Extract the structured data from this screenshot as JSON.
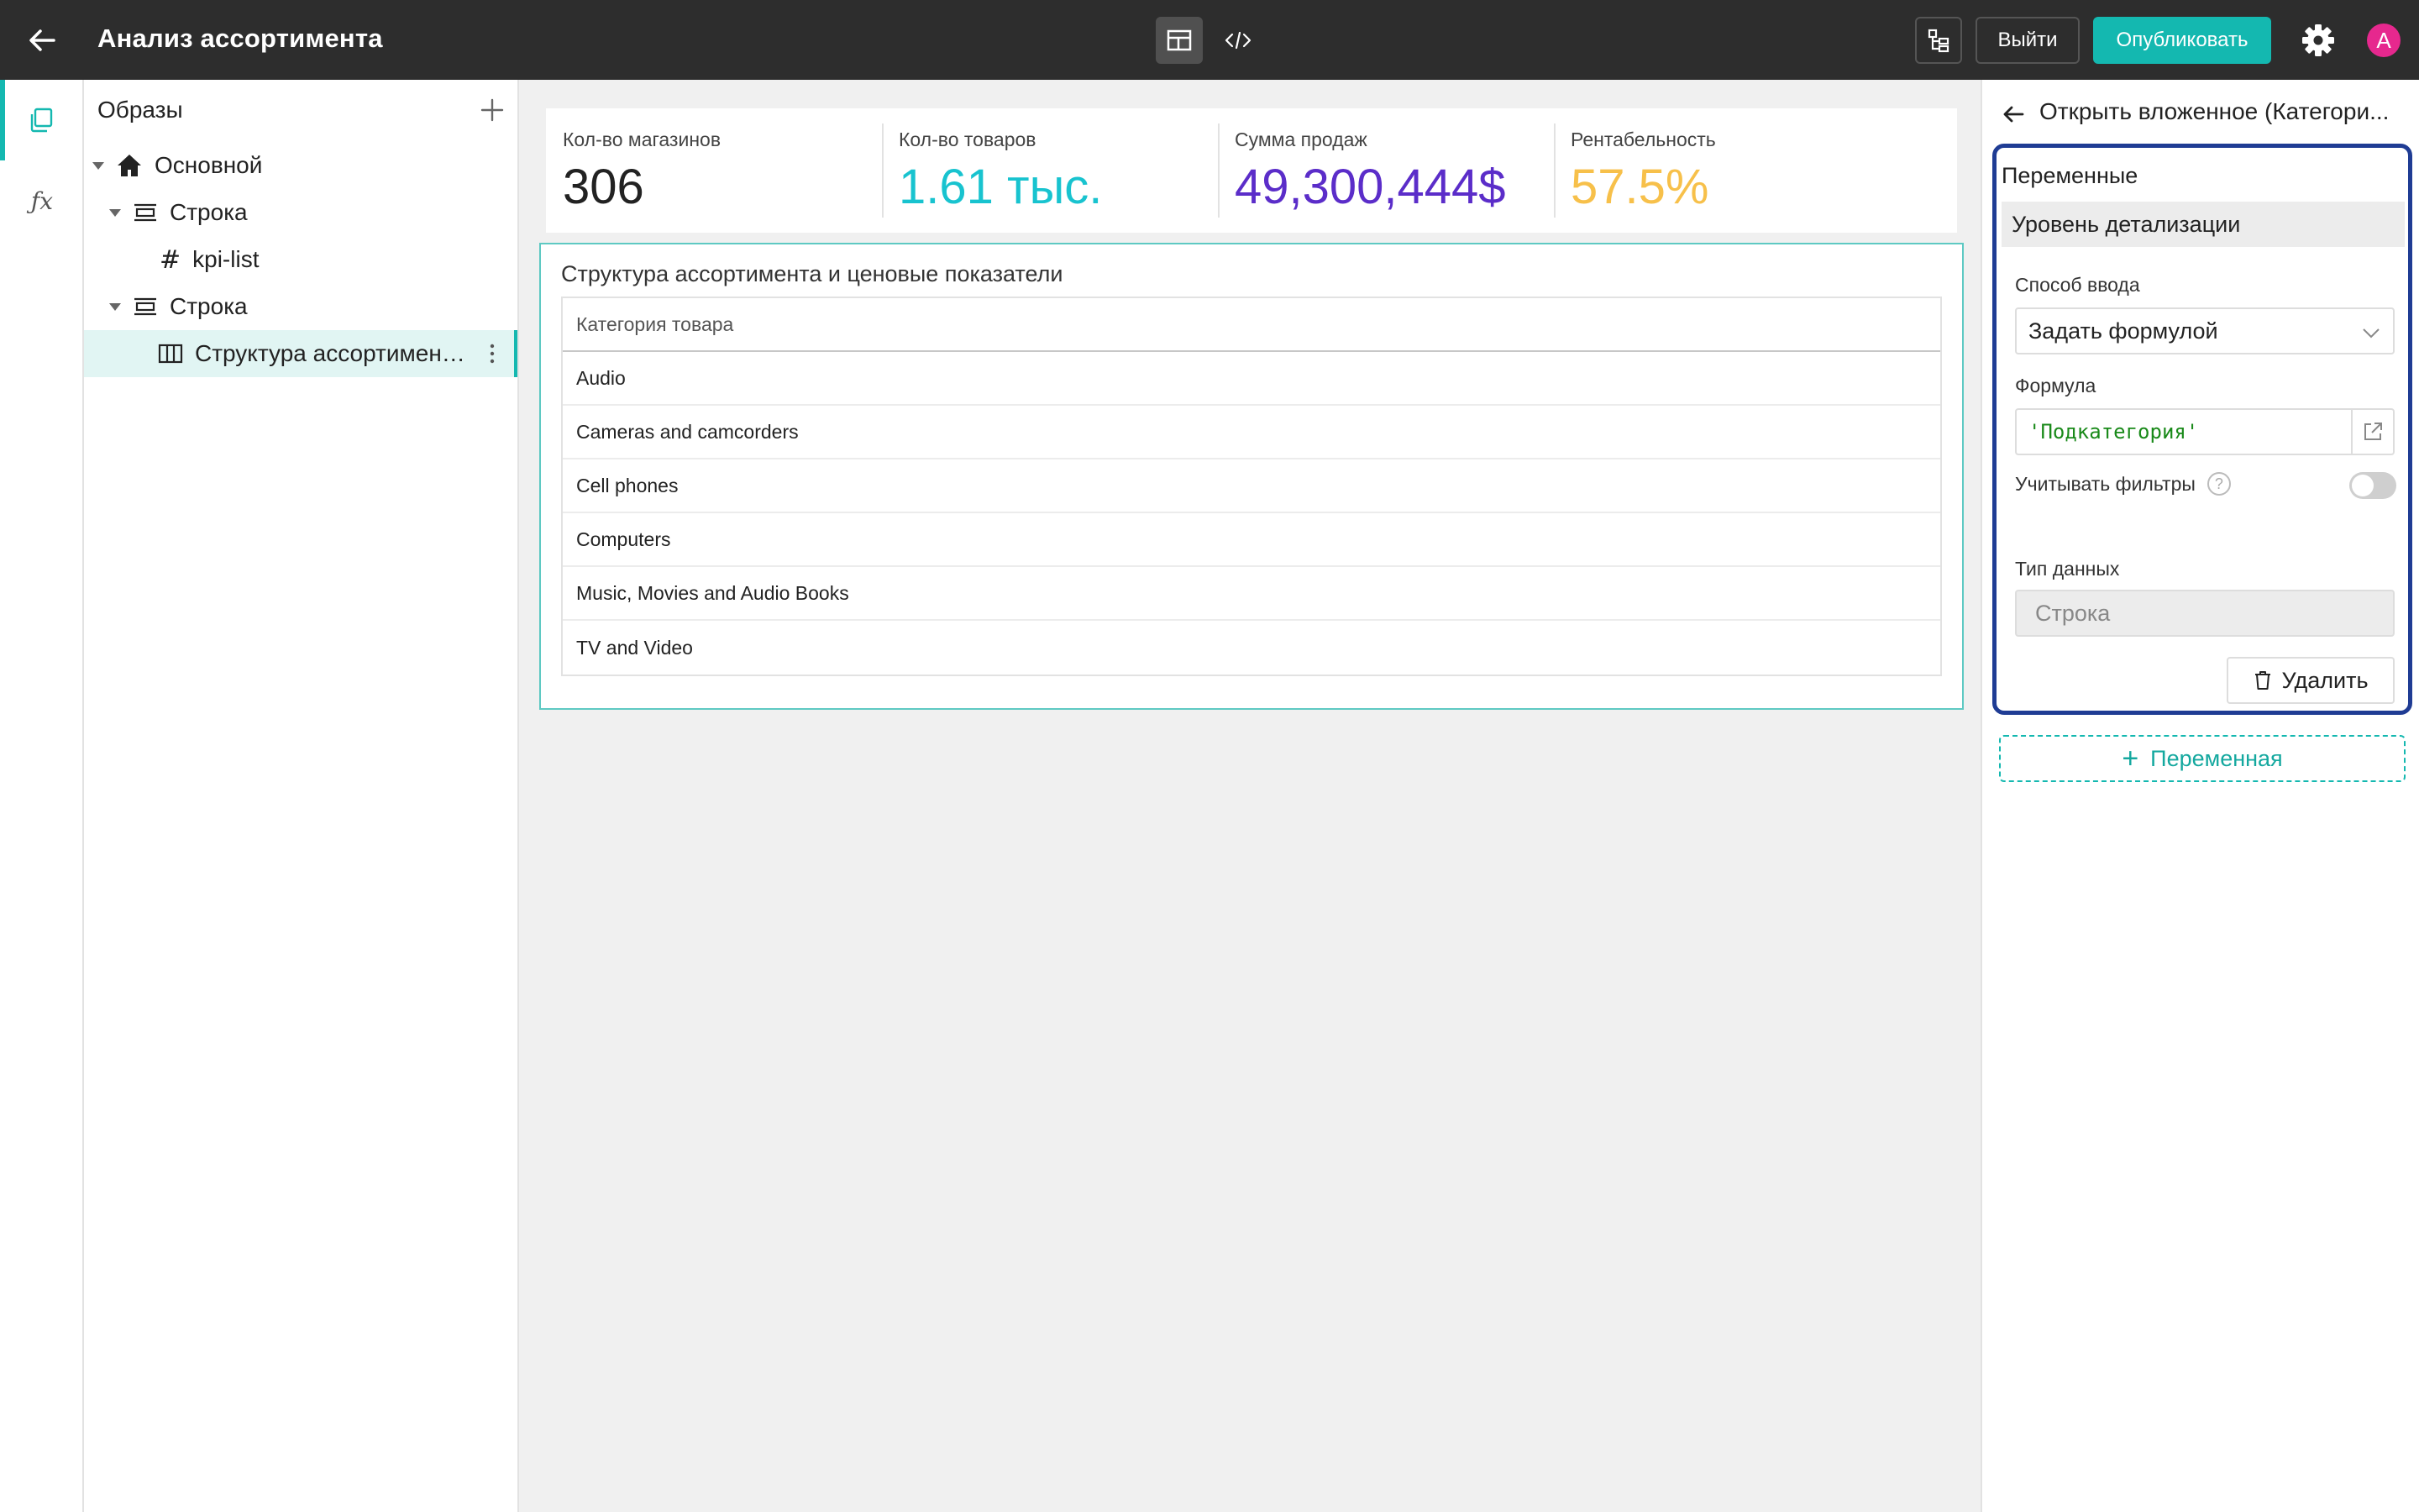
{
  "header": {
    "title": "Анализ ассортимента",
    "exit_label": "Выйти",
    "publish_label": "Опубликовать",
    "avatar_initial": "A"
  },
  "tree": {
    "title": "Образы",
    "items": [
      {
        "label": "Основной",
        "icon": "home-icon"
      },
      {
        "label": "Строка",
        "icon": "row-icon"
      },
      {
        "label": "kpi-list",
        "icon": "hash-icon"
      },
      {
        "label": "Строка",
        "icon": "row-icon"
      },
      {
        "label": "Структура ассортимен…",
        "icon": "table-columns-icon"
      }
    ]
  },
  "kpis": [
    {
      "label": "Кол-во магазинов",
      "value": "306",
      "color": "#222222"
    },
    {
      "label": "Кол-во товаров",
      "value": "1.61 тыс.",
      "color": "#18c3cf"
    },
    {
      "label": "Сумма продаж",
      "value": "49,300,444$",
      "color": "#5b2dc9"
    },
    {
      "label": "Рентабельность",
      "value": "57.5%",
      "color": "#f7c04a"
    }
  ],
  "table": {
    "title": "Структура ассортимента и ценовые показатели",
    "column": "Категория товара",
    "rows": [
      "Audio",
      "Cameras and camcorders",
      "Cell phones",
      "Computers",
      "Music, Movies and Audio Books",
      "TV and Video"
    ]
  },
  "panel": {
    "title": "Открыть вложенное (Категори...",
    "variables_heading": "Переменные",
    "variable_name": "Уровень детализации",
    "input_method_label": "Способ ввода",
    "input_method_value": "Задать формулой",
    "formula_label": "Формула",
    "formula_value": "'Подкатегория'",
    "filters_label": "Учитывать фильтры",
    "filters_on": false,
    "data_type_label": "Тип данных",
    "data_type_value": "Строка",
    "delete_label": "Удалить",
    "add_variable_label": "Переменная"
  },
  "colors": {
    "accent": "#14b8b0",
    "topbar": "#2d2d2d",
    "highlight_border": "#1f3c94"
  }
}
